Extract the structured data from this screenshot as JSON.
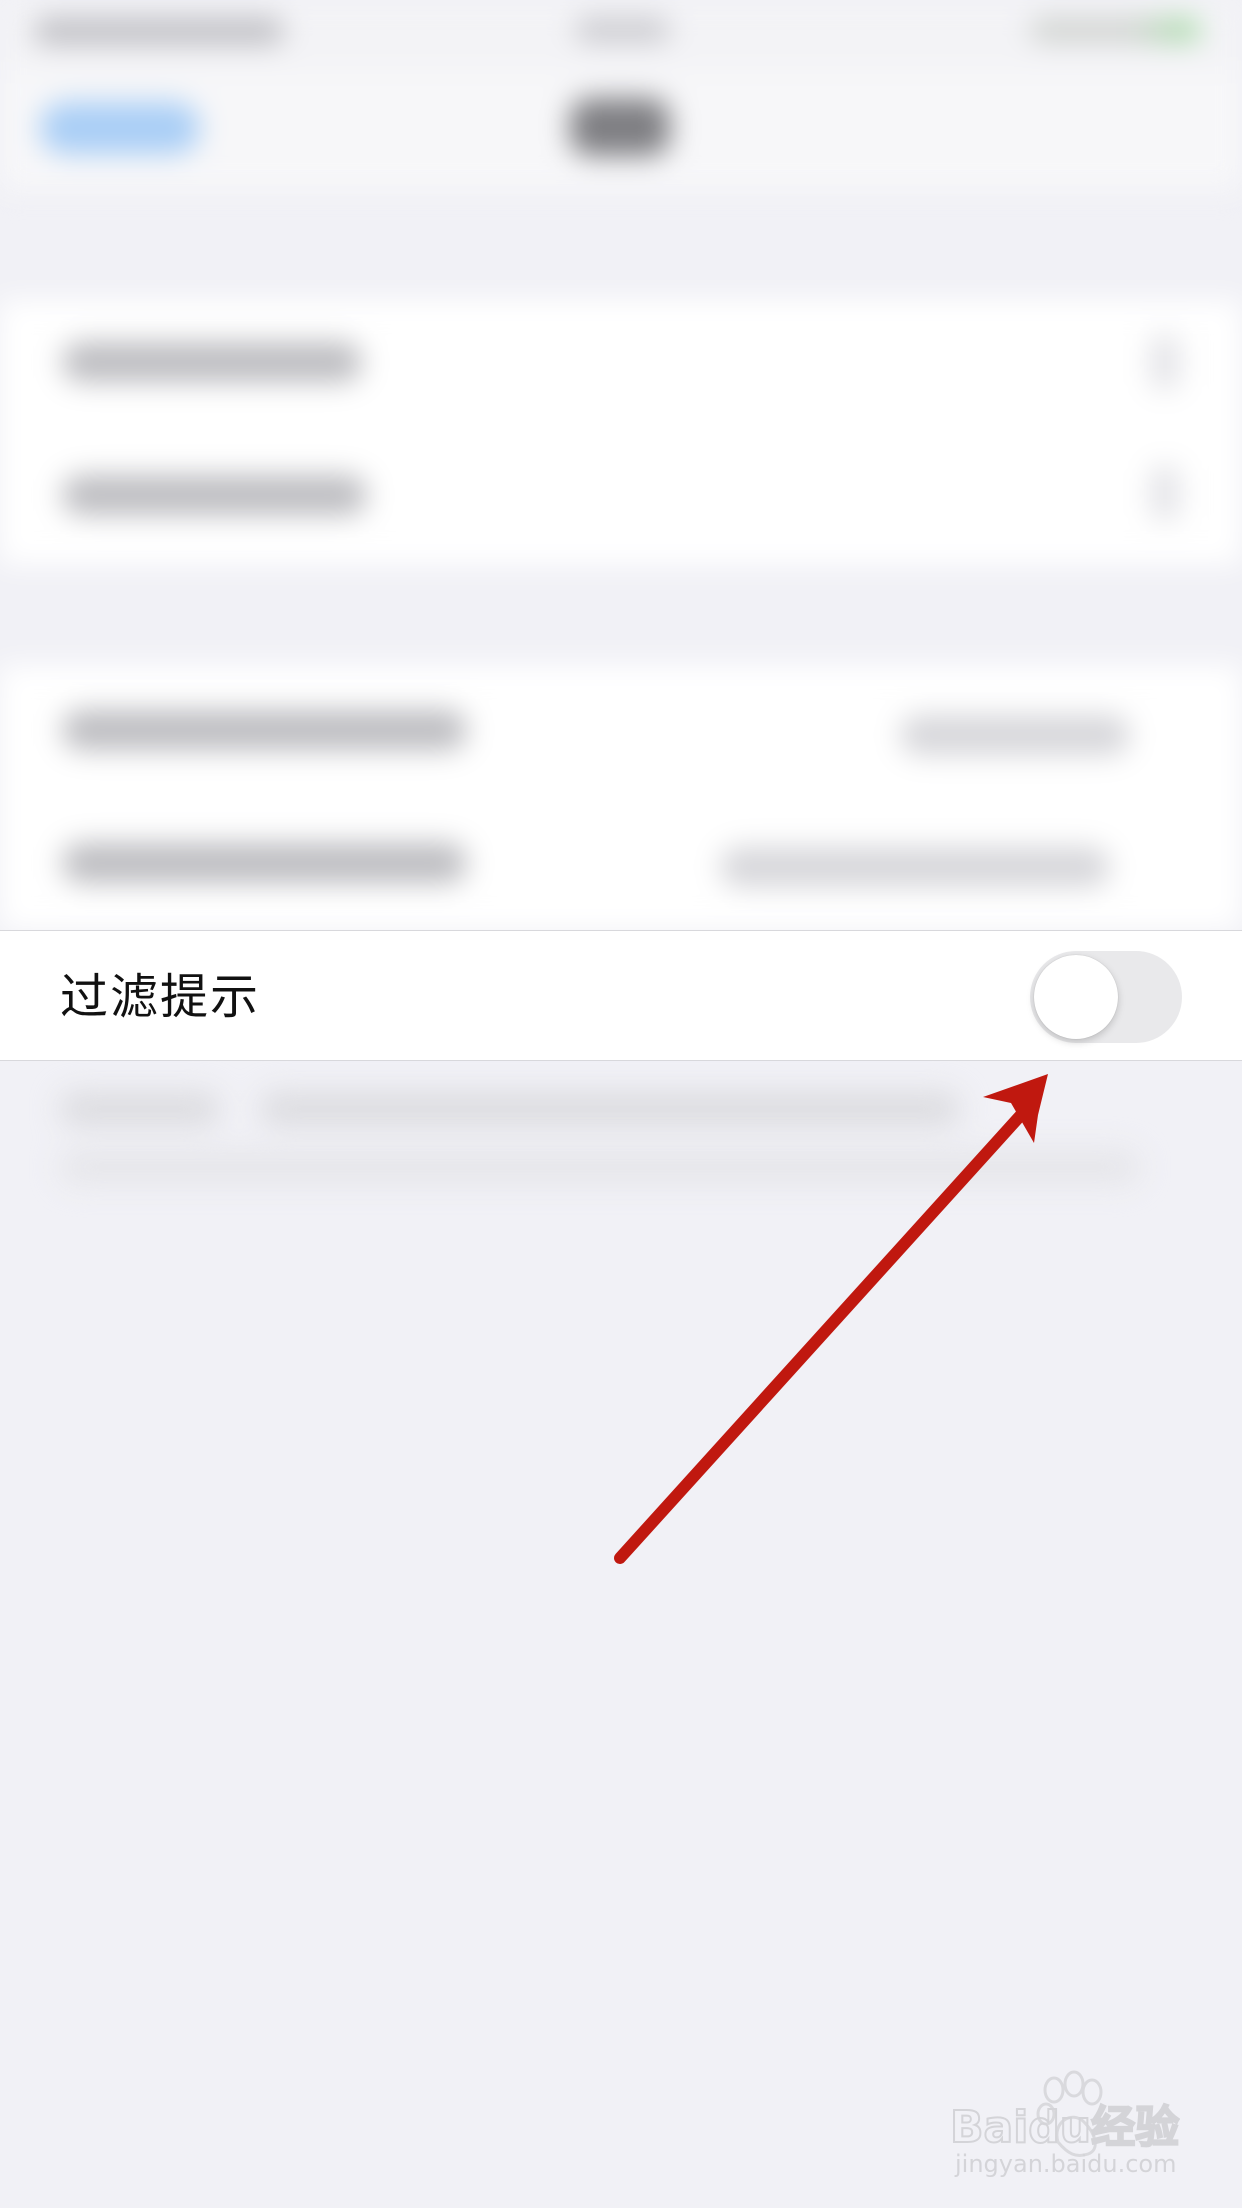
{
  "setting_row": {
    "label": "过滤提示",
    "toggle_on": false
  },
  "watermark": {
    "logo_text": "Baidu经验",
    "url_text": "jingyan.baidu.com"
  },
  "colors": {
    "background": "#f1f1f6",
    "toggle_off_track": "#e9e9eb",
    "arrow": "#c0180f"
  },
  "icons": {
    "watermark_icon": "baidu-paw-icon"
  }
}
